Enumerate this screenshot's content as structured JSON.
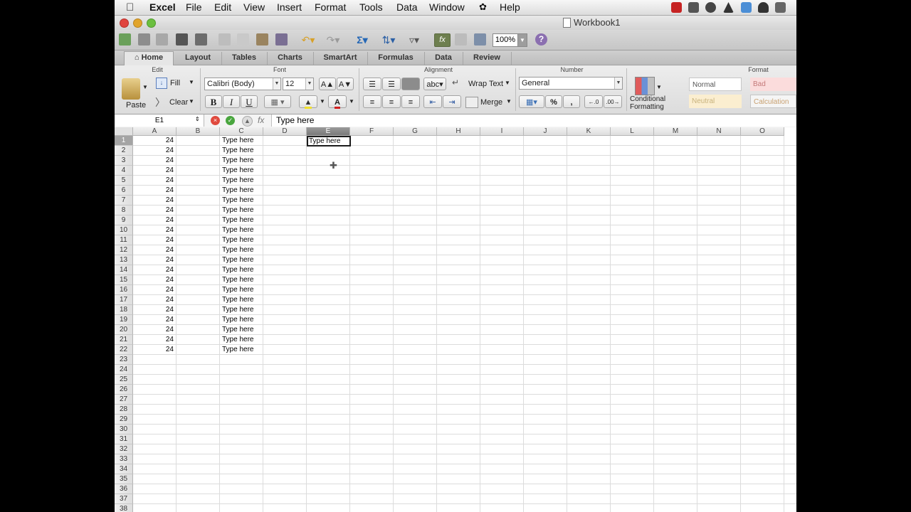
{
  "menubar": {
    "app_name": "Excel",
    "items": [
      "File",
      "Edit",
      "View",
      "Insert",
      "Format",
      "Tools",
      "Data",
      "Window",
      "Help"
    ]
  },
  "window": {
    "title": "Workbook1"
  },
  "toolbar": {
    "zoom": "100%"
  },
  "ribbon_tabs": [
    "Home",
    "Layout",
    "Tables",
    "Charts",
    "SmartArt",
    "Formulas",
    "Data",
    "Review"
  ],
  "ribbon": {
    "groups": {
      "edit": "Edit",
      "font": "Font",
      "alignment": "Alignment",
      "number": "Number",
      "format": "Format"
    },
    "paste": "Paste",
    "fill": "Fill",
    "clear": "Clear",
    "font_name": "Calibri (Body)",
    "font_size": "12",
    "bold": "B",
    "italic": "I",
    "underline": "U",
    "wrap_text": "Wrap Text",
    "merge": "Merge",
    "number_format": "General",
    "percent": "%",
    "comma": ",",
    "conditional_formatting": [
      "Conditional",
      "Formatting"
    ],
    "styles": [
      "Normal",
      "Bad",
      "Neutral",
      "Calculation"
    ]
  },
  "formula_bar": {
    "name_box": "E1",
    "fx": "fx",
    "content": "Type here"
  },
  "grid": {
    "columns": [
      "A",
      "B",
      "C",
      "D",
      "E",
      "F",
      "G",
      "H",
      "I",
      "J",
      "K",
      "L",
      "M",
      "N",
      "O"
    ],
    "row_count": 38,
    "col_a_value": "24",
    "col_c_value": "Type here",
    "filled_rows": 22,
    "active_cell_value": "Type here",
    "selected_column": "E",
    "selected_row": "1"
  },
  "colors": {
    "accent_red": "#d9382c",
    "accent_green": "#3ea53a",
    "selected_header": "#8a8a8a"
  }
}
